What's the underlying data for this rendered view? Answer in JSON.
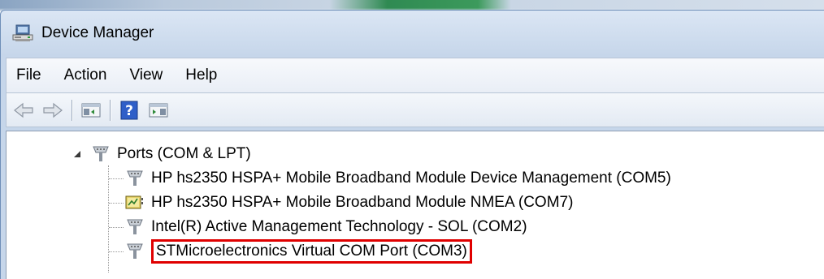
{
  "window": {
    "title": "Device Manager"
  },
  "menu": [
    {
      "label": "File"
    },
    {
      "label": "Action"
    },
    {
      "label": "View"
    },
    {
      "label": "Help"
    }
  ],
  "toolbar": {
    "buttons": [
      "back-icon",
      "forward-icon",
      "show-hide-console-tree-icon",
      "help-icon",
      "show-hide-action-pane-icon"
    ]
  },
  "tree": {
    "category": {
      "label": "Ports (COM & LPT)",
      "expanded": true
    },
    "devices": [
      {
        "label": "HP hs2350 HSPA+ Mobile Broadband Module Device Management (COM5)",
        "icon": "port-icon"
      },
      {
        "label": "HP hs2350 HSPA+ Mobile Broadband Module NMEA (COM7)",
        "icon": "nmea-port-icon"
      },
      {
        "label": "Intel(R) Active Management Technology - SOL (COM2)",
        "icon": "port-icon"
      },
      {
        "label": "STMicroelectronics Virtual COM Port (COM3)",
        "icon": "port-icon",
        "highlighted": true
      }
    ]
  },
  "colors": {
    "highlight_border": "#e00000",
    "window_frame": "#c6d6ea"
  }
}
